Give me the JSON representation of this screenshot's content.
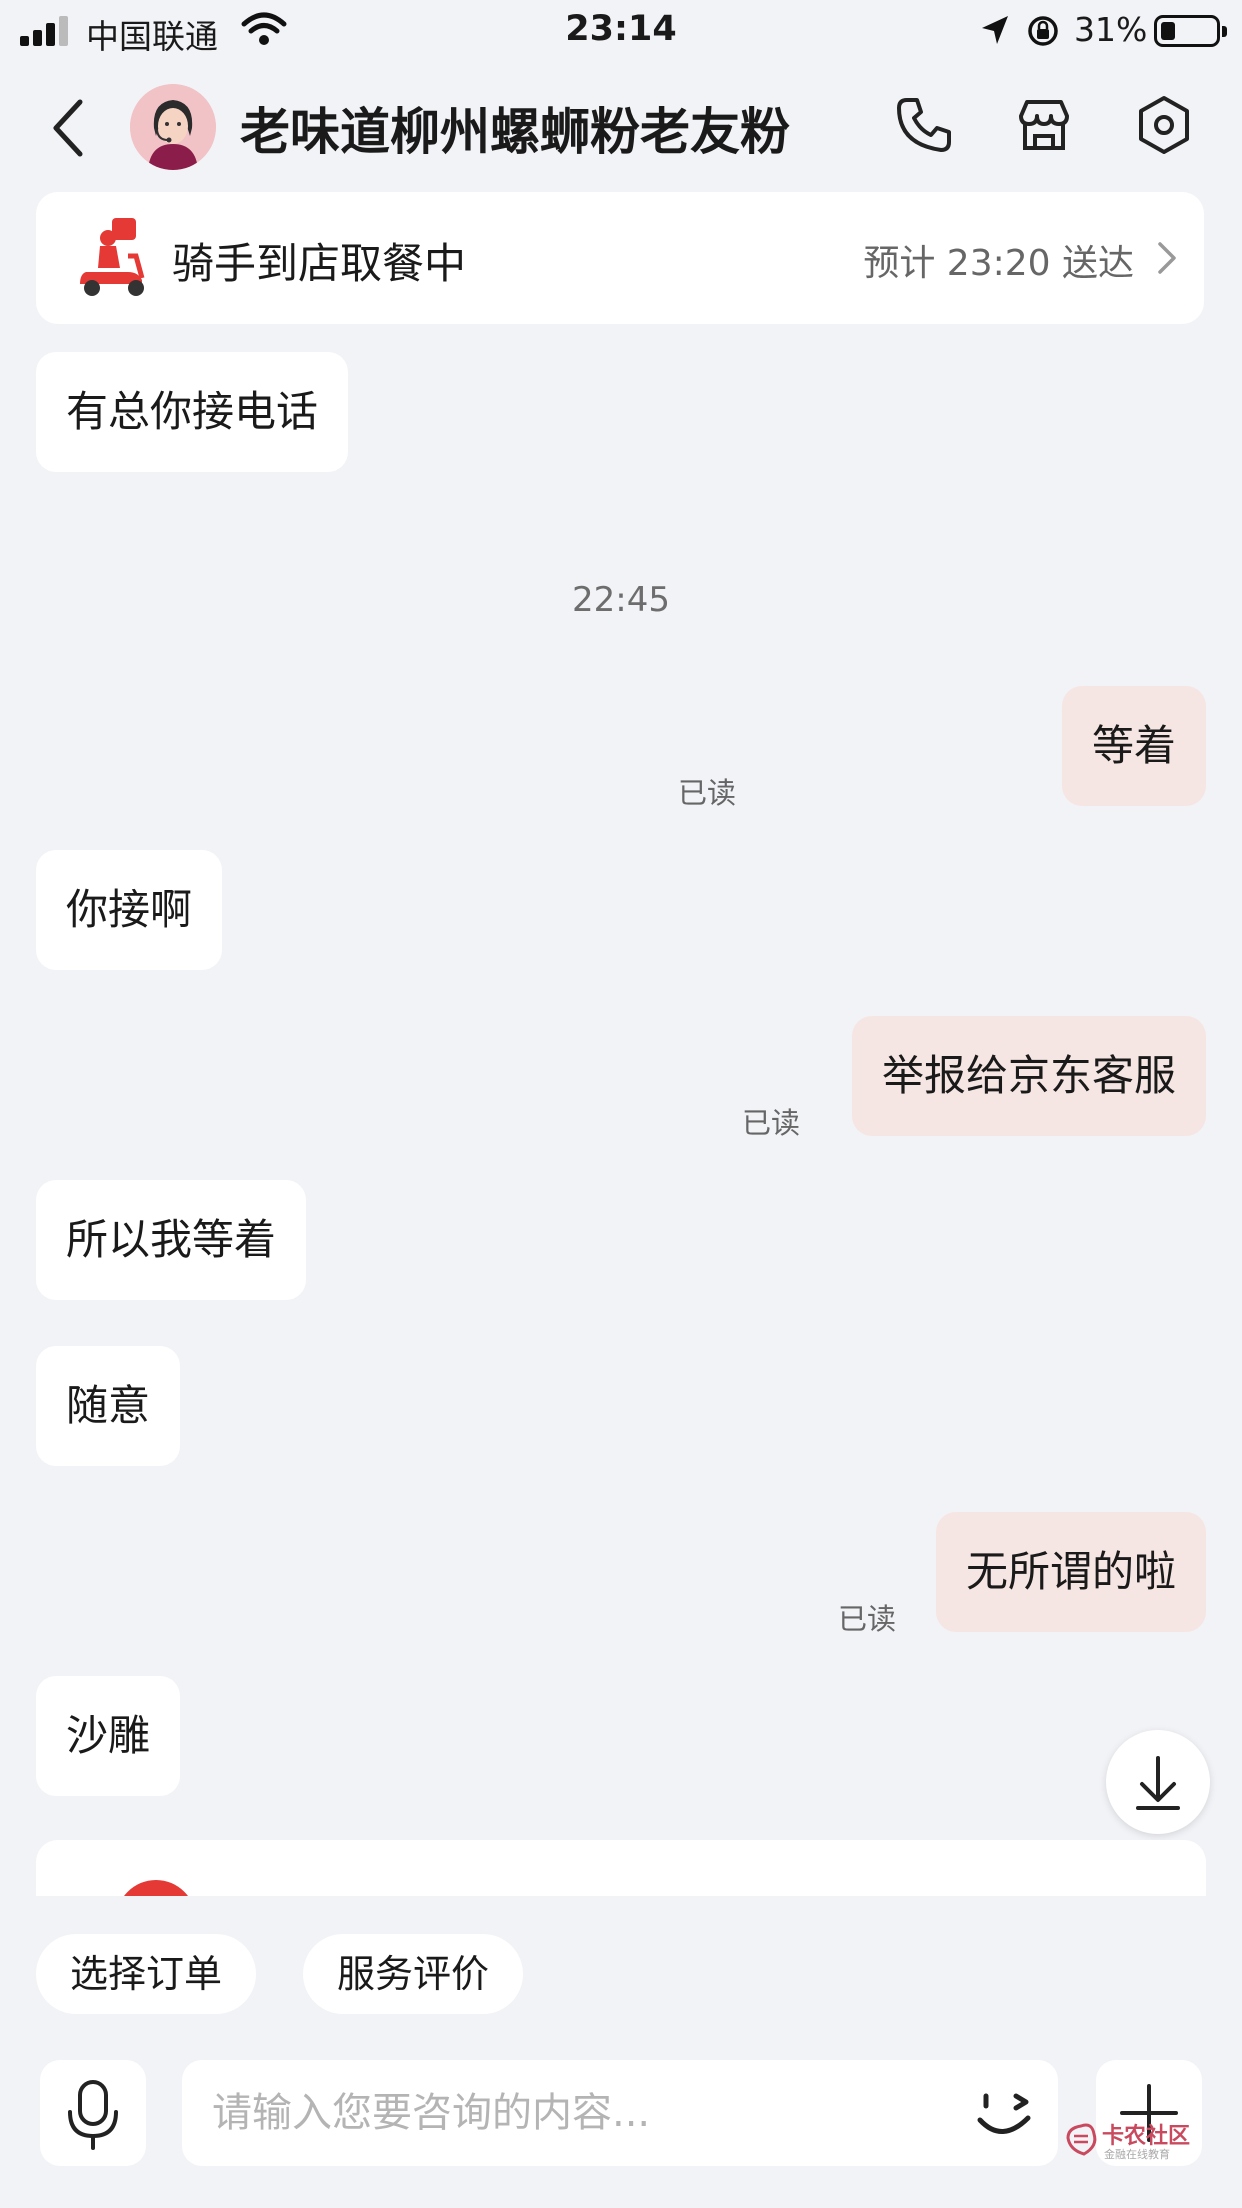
{
  "status_bar": {
    "carrier": "中国联通",
    "time": "23:14",
    "battery": "31%"
  },
  "header": {
    "title": "老味道柳州螺蛳粉老友粉",
    "icons": [
      "chevron-left-icon",
      "phone-icon",
      "store-icon",
      "settings-hexagon-icon"
    ]
  },
  "delivery": {
    "status": "骑手到店取餐中",
    "eta": "预计 23:20 送达",
    "icon": "rider-scooter-icon"
  },
  "timestamp": "22:45",
  "messages": [
    {
      "side": "left",
      "text": "有总你接电话"
    },
    {
      "side": "right",
      "text": "等着",
      "status": "已读"
    },
    {
      "side": "left",
      "text": "你接啊"
    },
    {
      "side": "right",
      "text": "举报给京东客服",
      "status": "已读"
    },
    {
      "side": "left",
      "text": "所以我等着"
    },
    {
      "side": "left",
      "text": "随意"
    },
    {
      "side": "right",
      "text": "无所谓的啦",
      "status": "已读"
    },
    {
      "side": "left",
      "text": "沙雕"
    }
  ],
  "quick_actions": [
    "选择订单",
    "服务评价"
  ],
  "input": {
    "placeholder": "请输入您要咨询的内容..."
  },
  "watermark": {
    "main": "卡农社区",
    "sub": "金融在线教育"
  },
  "colors": {
    "background": "#f2f3f7",
    "bubble_left": "#ffffff",
    "bubble_right": "#f6e6e3",
    "rider_red": "#e53935"
  }
}
